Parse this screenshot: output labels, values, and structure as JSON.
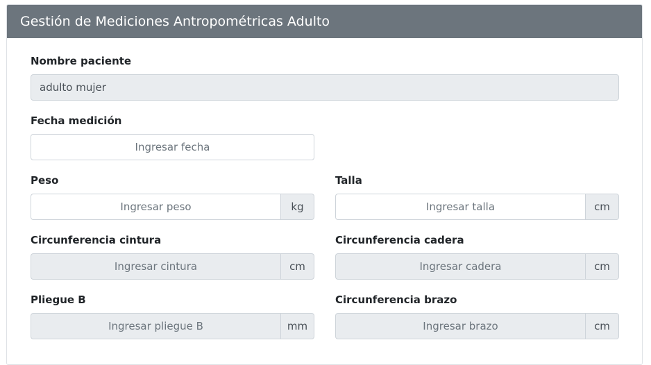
{
  "card": {
    "title": "Gestión de Mediciones Antropométricas Adulto"
  },
  "form": {
    "nombre": {
      "label": "Nombre paciente",
      "value": "adulto mujer"
    },
    "fecha": {
      "label": "Fecha medición",
      "placeholder": "Ingresar fecha"
    },
    "peso": {
      "label": "Peso",
      "placeholder": "Ingresar peso",
      "unit": "kg"
    },
    "talla": {
      "label": "Talla",
      "placeholder": "Ingresar talla",
      "unit": "cm"
    },
    "cintura": {
      "label": "Circunferencia cintura",
      "placeholder": "Ingresar cintura",
      "unit": "cm"
    },
    "cadera": {
      "label": "Circunferencia cadera",
      "placeholder": "Ingresar cadera",
      "unit": "cm"
    },
    "plieguebu": {
      "label": "Pliegue B",
      "placeholder": "Ingresar pliegue B",
      "unit": "mm"
    },
    "brazo": {
      "label": "Circunferencia brazo",
      "placeholder": "Ingresar brazo",
      "unit": "cm"
    }
  }
}
